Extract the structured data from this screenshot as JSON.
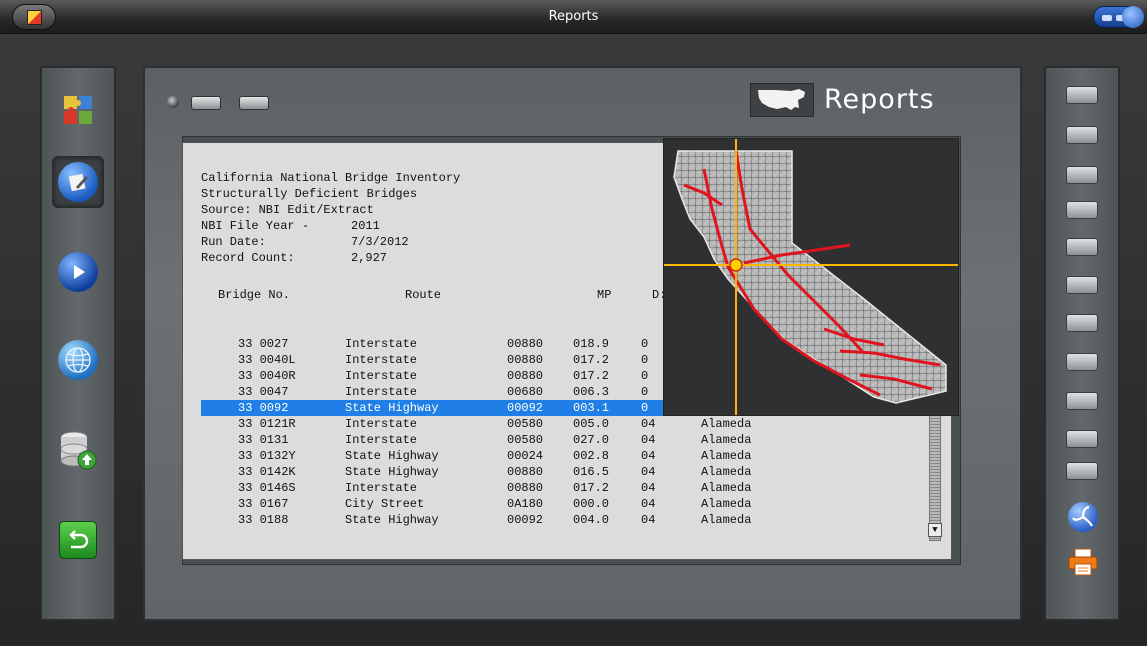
{
  "window": {
    "title": "Reports"
  },
  "header": {
    "badge_label": "Reports"
  },
  "report": {
    "header_lines": [
      {
        "label": "California National Bridge Inventory",
        "value": ""
      },
      {
        "label": "Structurally Deficient Bridges",
        "value": ""
      },
      {
        "label": "Source: NBI Edit/Extract",
        "value": ""
      },
      {
        "label": "NBI File Year -",
        "value": "2011"
      },
      {
        "label": "Run Date:",
        "value": "7/3/2012"
      },
      {
        "label": "Record Count:",
        "value": "2,927"
      }
    ],
    "columns": {
      "bridge_no": "Bridge No.",
      "route": "Route",
      "mp": "MP",
      "district": "D:"
    },
    "rows": [
      {
        "bridge": "33 0027",
        "route": "Interstate",
        "code": "00880",
        "mp": "018.9",
        "district": "0",
        "county": ""
      },
      {
        "bridge": "33 0040L",
        "route": "Interstate",
        "code": "00880",
        "mp": "017.2",
        "district": "0",
        "county": ""
      },
      {
        "bridge": "33 0040R",
        "route": "Interstate",
        "code": "00880",
        "mp": "017.2",
        "district": "0",
        "county": ""
      },
      {
        "bridge": "33 0047",
        "route": "Interstate",
        "code": "00680",
        "mp": "006.3",
        "district": "0",
        "county": ""
      },
      {
        "bridge": "33 0092",
        "route": "State Highway",
        "code": "00092",
        "mp": "003.1",
        "district": "0",
        "county": ""
      },
      {
        "bridge": "33 0121R",
        "route": "Interstate",
        "code": "00580",
        "mp": "005.0",
        "district": "04",
        "county": "Alameda"
      },
      {
        "bridge": "33 0131",
        "route": "Interstate",
        "code": "00580",
        "mp": "027.0",
        "district": "04",
        "county": "Alameda"
      },
      {
        "bridge": "33 0132Y",
        "route": "State Highway",
        "code": "00024",
        "mp": "002.8",
        "district": "04",
        "county": "Alameda"
      },
      {
        "bridge": "33 0142K",
        "route": "State Highway",
        "code": "00880",
        "mp": "016.5",
        "district": "04",
        "county": "Alameda"
      },
      {
        "bridge": "33 0146S",
        "route": "Interstate",
        "code": "00880",
        "mp": "017.2",
        "district": "04",
        "county": "Alameda"
      },
      {
        "bridge": "33 0167",
        "route": "City Street",
        "code": "0A180",
        "mp": "000.0",
        "district": "04",
        "county": "Alameda"
      },
      {
        "bridge": "33 0188",
        "route": "State Highway",
        "code": "00092",
        "mp": "004.0",
        "district": "04",
        "county": "Alameda"
      }
    ],
    "selected_row": 4
  },
  "colors": {
    "selection": "#1f7fe6",
    "route_red": "#e0141e",
    "crosshair": "#ffb400"
  },
  "icons": {
    "left": [
      "puzzle-icon",
      "document-edit-icon",
      "play-icon",
      "globe-icon",
      "database-upload-icon",
      "undo-icon"
    ],
    "right_bottom": [
      "triskelion-icon",
      "printer-icon"
    ]
  }
}
